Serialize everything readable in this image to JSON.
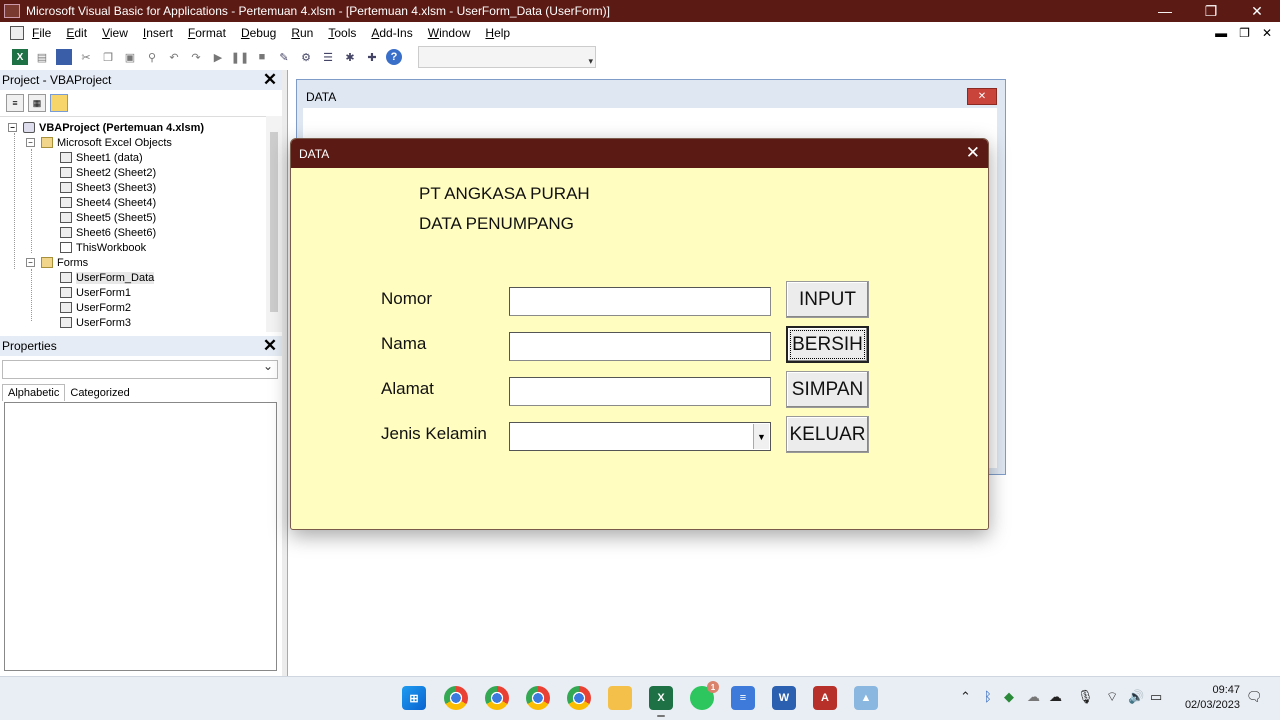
{
  "window": {
    "title": "Microsoft Visual Basic for Applications - Pertemuan 4.xlsm - [Pertemuan 4.xlsm - UserForm_Data (UserForm)]",
    "minimize": "—",
    "maximize": "❐",
    "close": "✕"
  },
  "menu": [
    "File",
    "Edit",
    "View",
    "Insert",
    "Format",
    "Debug",
    "Run",
    "Tools",
    "Add-Ins",
    "Window",
    "Help"
  ],
  "mdi_controls": [
    "▬",
    "❐",
    "✕"
  ],
  "project_pane": {
    "title": "Project - VBAProject",
    "close": "✕",
    "tree": {
      "root": "VBAProject (Pertemuan 4.xlsm)",
      "excel_objects_folder": "Microsoft Excel Objects",
      "sheets": [
        "Sheet1 (data)",
        "Sheet2 (Sheet2)",
        "Sheet3 (Sheet3)",
        "Sheet4 (Sheet4)",
        "Sheet5 (Sheet5)",
        "Sheet6 (Sheet6)"
      ],
      "workbook": "ThisWorkbook",
      "forms_folder": "Forms",
      "forms": [
        "UserForm_Data",
        "UserForm1",
        "UserForm2",
        "UserForm3"
      ]
    }
  },
  "properties_pane": {
    "title": "Properties",
    "close": "✕",
    "tabs": [
      "Alphabetic",
      "Categorized"
    ]
  },
  "designer_window": {
    "title": "DATA",
    "close": "✕"
  },
  "form": {
    "title": "DATA",
    "close": "✕",
    "heading1": "PT ANGKASA PURAH",
    "heading2": "DATA PENUMPANG",
    "labels": {
      "nomor": "Nomor",
      "nama": "Nama",
      "alamat": "Alamat",
      "jenis_kelamin": "Jenis Kelamin"
    },
    "values": {
      "nomor": "",
      "nama": "",
      "alamat": "",
      "jenis_kelamin": ""
    },
    "buttons": {
      "input": "INPUT",
      "bersih": "BERSIH",
      "simpan": "SIMPAN",
      "keluar": "KELUAR"
    }
  },
  "taskbar": {
    "clock_time": "09:47",
    "clock_date": "02/03/2023",
    "whatsapp_badge": "1"
  }
}
